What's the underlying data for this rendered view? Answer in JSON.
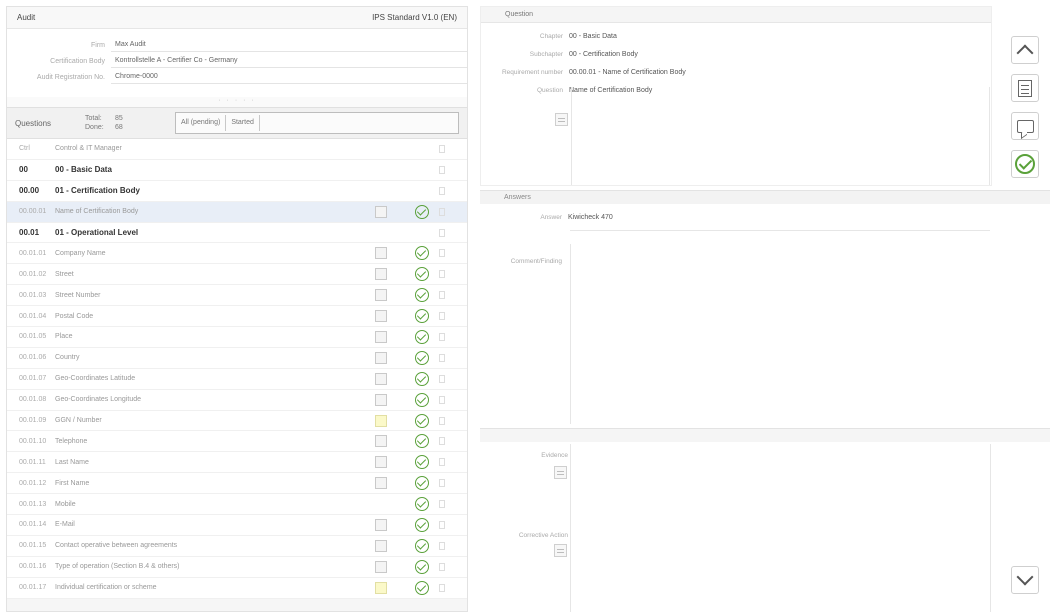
{
  "left_header": {
    "title": "Audit",
    "standard": "IPS Standard V1.0 (EN)"
  },
  "info": [
    {
      "label": "Firm",
      "value": "Max Audit"
    },
    {
      "label": "Certification Body",
      "value": "Kontrollstelle A - Certifier Co - Germany"
    },
    {
      "label": "Audit Registration No.",
      "value": "Chrome-0000"
    }
  ],
  "grip": "· · · · ·",
  "questions_bar": {
    "label": "Questions",
    "stats": [
      {
        "k": "Total:",
        "v": "85"
      },
      {
        "k": "Done:",
        "v": "68"
      }
    ],
    "filters": [
      "All (pending)",
      "Started"
    ]
  },
  "rows": [
    {
      "code": "Ctrl",
      "name": "Control & IT Manager",
      "type": "plain"
    },
    {
      "code": "00",
      "name": "00 - Basic Data",
      "type": "hdr"
    },
    {
      "code": "00.00",
      "name": "01 - Certification Body",
      "type": "hdr"
    },
    {
      "code": "00.00.01",
      "name": "Name of Certification Body",
      "type": "sel",
      "ed": "grey",
      "ok": true
    },
    {
      "code": "00.01",
      "name": "01 - Operational Level",
      "type": "hdr"
    },
    {
      "code": "00.01.01",
      "name": "Company Name",
      "type": "plain",
      "ed": "grey",
      "ok": true
    },
    {
      "code": "00.01.02",
      "name": "Street",
      "type": "plain",
      "ed": "grey",
      "ok": true
    },
    {
      "code": "00.01.03",
      "name": "Street Number",
      "type": "plain",
      "ed": "grey",
      "ok": true
    },
    {
      "code": "00.01.04",
      "name": "Postal Code",
      "type": "plain",
      "ed": "grey",
      "ok": true
    },
    {
      "code": "00.01.05",
      "name": "Place",
      "type": "plain",
      "ed": "grey",
      "ok": true
    },
    {
      "code": "00.01.06",
      "name": "Country",
      "type": "plain",
      "ed": "grey",
      "ok": true
    },
    {
      "code": "00.01.07",
      "name": "Geo-Coordinates Latitude",
      "type": "plain",
      "ed": "grey",
      "ok": true
    },
    {
      "code": "00.01.08",
      "name": "Geo-Coordinates Longitude",
      "type": "plain",
      "ed": "grey",
      "ok": true
    },
    {
      "code": "00.01.09",
      "name": "GGN / Number",
      "type": "plain",
      "ed": "yellow",
      "ok": true
    },
    {
      "code": "00.01.10",
      "name": "Telephone",
      "type": "plain",
      "ed": "grey",
      "ok": true
    },
    {
      "code": "00.01.11",
      "name": "Last Name",
      "type": "plain",
      "ed": "grey",
      "ok": true
    },
    {
      "code": "00.01.12",
      "name": "First Name",
      "type": "plain",
      "ed": "grey",
      "ok": true
    },
    {
      "code": "00.01.13",
      "name": "Mobile",
      "type": "plain",
      "ed": "none",
      "ok": true
    },
    {
      "code": "00.01.14",
      "name": "E-Mail",
      "type": "plain",
      "ed": "grey",
      "ok": true
    },
    {
      "code": "00.01.15",
      "name": "Contact operative between agreements",
      "type": "plain",
      "ed": "grey",
      "ok": true
    },
    {
      "code": "00.01.16",
      "name": "Type of operation (Section B.4 & others)",
      "type": "plain",
      "ed": "grey",
      "ok": true
    },
    {
      "code": "00.01.17",
      "name": "Individual certification or scheme",
      "type": "plain",
      "ed": "yellow",
      "ok": true
    }
  ],
  "question_panel": {
    "header": "Question",
    "fields": [
      {
        "label": "Chapter",
        "value": "00 - Basic Data"
      },
      {
        "label": "Subchapter",
        "value": "00 - Certification Body"
      },
      {
        "label": "Requirement number",
        "value": "00.00.01 - Name of Certification Body"
      },
      {
        "label": "Question",
        "value": "Name of Certification Body"
      }
    ]
  },
  "answer_panel": {
    "header": "Answers",
    "fields": [
      {
        "label": "Answer",
        "value": "Kiwicheck 470"
      },
      {
        "label": "Comment/Finding",
        "value": ""
      }
    ]
  },
  "bottom_panel": {
    "labels": [
      "Evidence",
      "Corrective Action"
    ]
  },
  "toolbar": {
    "up": "previous-question",
    "doc": "documents",
    "comment": "comments",
    "ok": "confirm",
    "down": "next-question"
  },
  "colors": {
    "ok_green": "#5aa13a",
    "selected_row": "#e8eef7",
    "highlight_yellow": "#fbf9c9"
  }
}
